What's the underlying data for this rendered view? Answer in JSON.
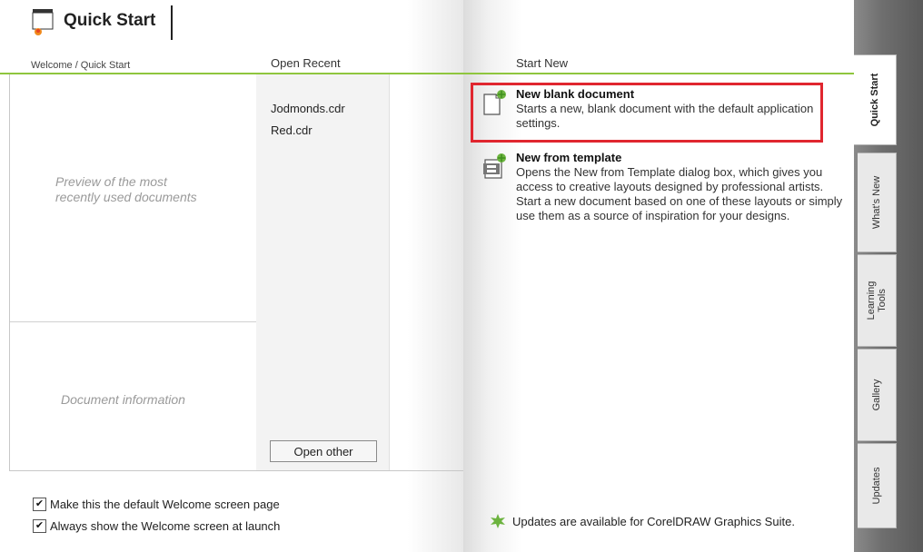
{
  "header": {
    "title": "Quick Start"
  },
  "columns": {
    "welcome": "Welcome / Quick Start",
    "open_recent": "Open Recent",
    "start_new": "Start New"
  },
  "preview": {
    "preview_text": "Preview of the most recently used documents",
    "doc_info": "Document information"
  },
  "recent_files": [
    "Jodmonds.cdr",
    "Red.cdr"
  ],
  "open_other_label": "Open other",
  "checkboxes": [
    {
      "label": "Make this the default Welcome screen page",
      "checked": true
    },
    {
      "label": "Always show the Welcome screen at launch",
      "checked": true
    }
  ],
  "start_new": [
    {
      "title": "New blank document",
      "desc": "Starts a new, blank document with the default application settings.",
      "icon": "new-document-icon"
    },
    {
      "title": "New from template",
      "desc": "Opens the New from Template dialog box, which gives you access to creative layouts designed by professional artists. Start a new document based on one of these layouts or simply use them as a source of inspiration for your designs.",
      "icon": "template-icon"
    }
  ],
  "update_text": "Updates are available for CorelDRAW Graphics Suite.",
  "tabs": [
    "Quick Start",
    "What's New",
    "Learning Tools",
    "Gallery",
    "Updates"
  ],
  "colors": {
    "accent_green": "#8fc63e",
    "highlight_red": "#e0262f"
  }
}
